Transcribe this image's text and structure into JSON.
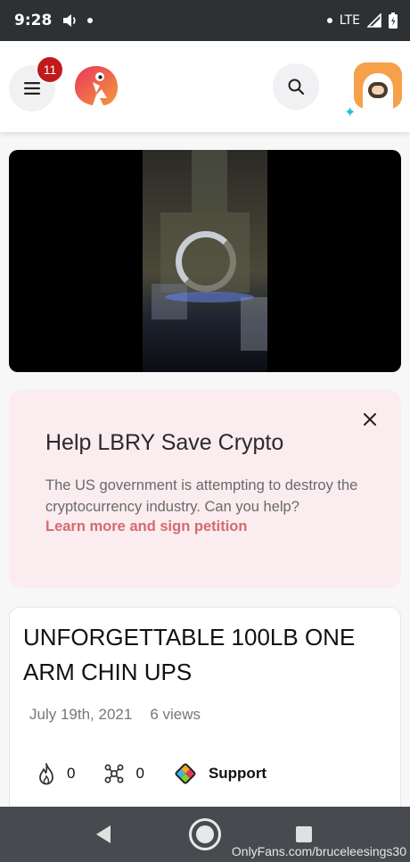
{
  "status_bar": {
    "time": "9:28",
    "network": "LTE"
  },
  "header": {
    "notification_count": "11",
    "icons": {
      "menu": "menu-icon",
      "search": "search-icon",
      "logo": "lbry-logo",
      "avatar": "user-avatar"
    }
  },
  "video": {
    "state": "loading"
  },
  "banner": {
    "title": "Help LBRY Save Crypto",
    "body": "The US government is attempting to destroy the cryptocurrency industry. Can you help?",
    "link": "Learn more and sign petition"
  },
  "content": {
    "title": "UNFORGETTABLE 100LB ONE ARM CHIN UPS",
    "date": "July 19th, 2021",
    "views": "6 views",
    "fire_count": "0",
    "slime_count": "0",
    "support_label": "Support"
  },
  "watermark": "OnlyFans.com/bruceleesings30",
  "colors": {
    "accent": "#d56a6f",
    "badge": "#c01a1a",
    "banner_bg": "#fbecef"
  }
}
